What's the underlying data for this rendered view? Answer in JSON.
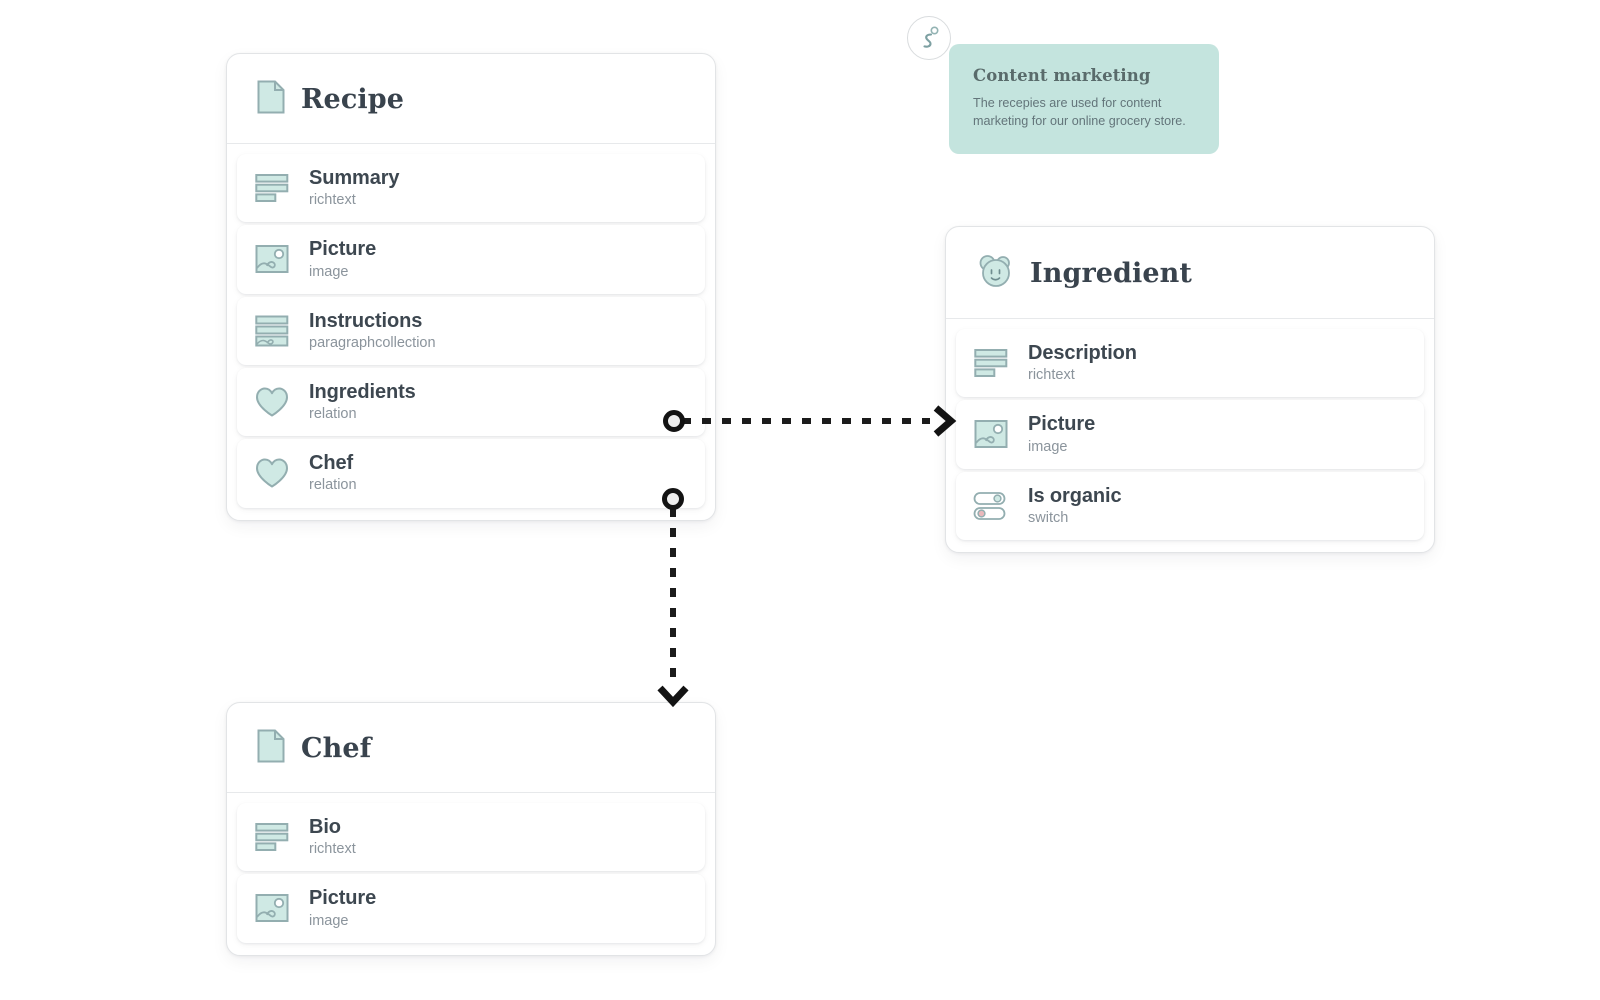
{
  "colors": {
    "accent_fill": "#cfe9e4",
    "accent_stroke": "#93aeb0",
    "note_bg": "#c4e4de",
    "card_border": "#e2e4e6",
    "title_text": "#39434d",
    "type_text": "#8b949c",
    "connector": "#1b1b1b",
    "switch_off": "#e9b8bb"
  },
  "entities": [
    {
      "id": "recipe",
      "title": "Recipe",
      "icon": "document-icon",
      "fields": [
        {
          "name": "Summary",
          "type": "richtext",
          "icon": "richtext-icon"
        },
        {
          "name": "Picture",
          "type": "image",
          "icon": "image-icon"
        },
        {
          "name": "Instructions",
          "type": "paragraphcollection",
          "icon": "paragraphcollection-icon"
        },
        {
          "name": "Ingredients",
          "type": "relation",
          "icon": "heart-icon"
        },
        {
          "name": "Chef",
          "type": "relation",
          "icon": "heart-icon"
        }
      ]
    },
    {
      "id": "ingredient",
      "title": "Ingredient",
      "icon": "bear-face-icon",
      "fields": [
        {
          "name": "Description",
          "type": "richtext",
          "icon": "richtext-icon"
        },
        {
          "name": "Picture",
          "type": "image",
          "icon": "image-icon"
        },
        {
          "name": "Is organic",
          "type": "switch",
          "icon": "switch-icon"
        }
      ]
    },
    {
      "id": "chef",
      "title": "Chef",
      "icon": "document-icon",
      "fields": [
        {
          "name": "Bio",
          "type": "richtext",
          "icon": "richtext-icon"
        },
        {
          "name": "Picture",
          "type": "image",
          "icon": "image-icon"
        }
      ]
    }
  ],
  "note": {
    "icon": "info-italic-icon",
    "title": "Content marketing",
    "body": "The recepies are used for content marketing for our online grocery store."
  },
  "connections": [
    {
      "id": "recipe-ingredients-to-ingredient",
      "from_field": "Ingredients",
      "to_entity": "Ingredient",
      "style": "dashed",
      "direction": "horizontal"
    },
    {
      "id": "recipe-chef-to-chef",
      "from_field": "Chef",
      "to_entity": "Chef",
      "style": "dashed",
      "direction": "vertical"
    }
  ]
}
